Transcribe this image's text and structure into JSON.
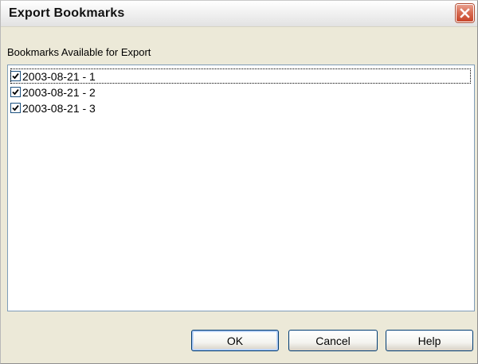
{
  "window": {
    "title": "Export Bookmarks",
    "close_icon": "close-icon"
  },
  "group": {
    "label": "Bookmarks Available for Export"
  },
  "bookmarks": [
    {
      "label": "2003-08-21 - 1",
      "checked": true,
      "focused": true
    },
    {
      "label": "2003-08-21 - 2",
      "checked": true,
      "focused": false
    },
    {
      "label": "2003-08-21 - 3",
      "checked": true,
      "focused": false
    }
  ],
  "buttons": {
    "ok": "OK",
    "cancel": "Cancel",
    "help": "Help"
  },
  "colors": {
    "dialog_background": "#ece9d8",
    "close_button": "#d86e55",
    "list_border": "#7f9db9"
  }
}
